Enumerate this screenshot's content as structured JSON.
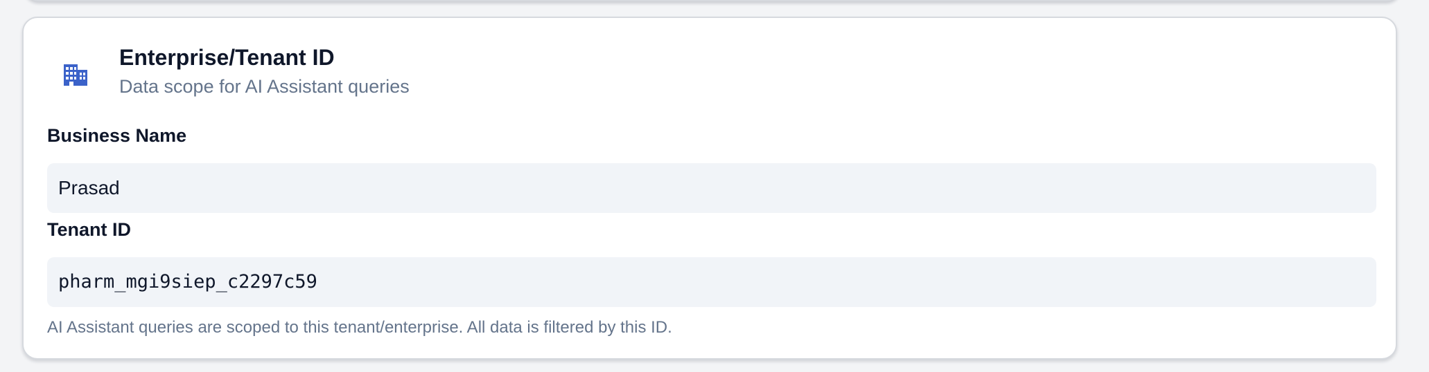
{
  "card": {
    "icon": "building-icon",
    "title": "Enterprise/Tenant ID",
    "subtitle": "Data scope for AI Assistant queries"
  },
  "fields": {
    "business_name": {
      "label": "Business Name",
      "value": "Prasad"
    },
    "tenant_id": {
      "label": "Tenant ID",
      "value": "pharm_mgi9siep_c2297c59"
    }
  },
  "hint": "AI Assistant queries are scoped to this tenant/enterprise. All data is filtered by this ID.",
  "colors": {
    "accent": "#3b62c9",
    "field_background": "#f1f4f8",
    "muted_text": "#64748b"
  }
}
